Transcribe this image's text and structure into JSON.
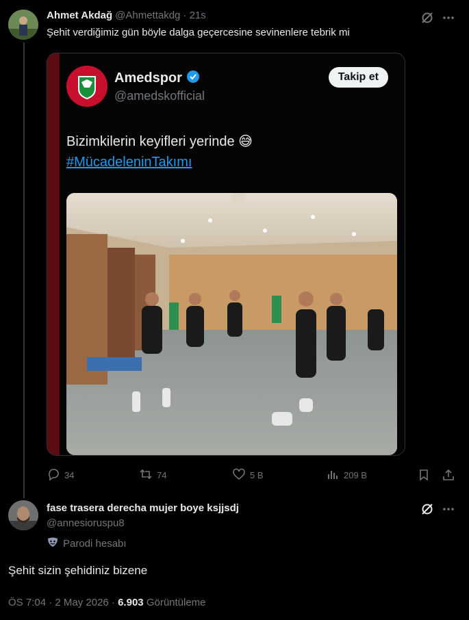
{
  "reply_parent": {
    "author_name": "Ahmet Akdağ",
    "handle": "@Ahmettakdg",
    "time": "· 21s",
    "text": "Şehit verdiğimiz gün böyle dalga geçercesine sevinenlere tebrik mi",
    "embedded": {
      "author_name": "Amedspor",
      "handle": "@amedskofficial",
      "follow_label": "Takip et",
      "text": "Bizimkilerin keyifleri yerinde 😅",
      "hashtag": "#MücadeleninTakımı"
    },
    "actions": {
      "replies": "34",
      "reposts": "74",
      "likes": "5 B",
      "views": "209 B"
    }
  },
  "main_tweet": {
    "author_name": "fase trasera derecha mujer boye ksjjsdj",
    "handle": "@annesioruspu8",
    "parody_label": "Parodi hesabı",
    "text": "Şehit sizin şehidiniz bizene",
    "meta_time": "ÖS 7:04 · 2 May 2026 ·",
    "meta_views_count": "6.903",
    "meta_views_label": "Görüntüleme"
  },
  "colors": {
    "background": "#000000",
    "text": "#e7e9ea",
    "muted": "#71767b",
    "link": "#1d9bf0",
    "verified": "#1d9bf0",
    "amedspor_red": "#c8102e",
    "amedspor_green": "#1a8f3c"
  },
  "icons": [
    "grok-icon",
    "more-icon",
    "reply-icon",
    "repost-icon",
    "like-icon",
    "views-icon",
    "bookmark-icon",
    "share-icon",
    "verified-icon",
    "parody-mask-icon"
  ]
}
